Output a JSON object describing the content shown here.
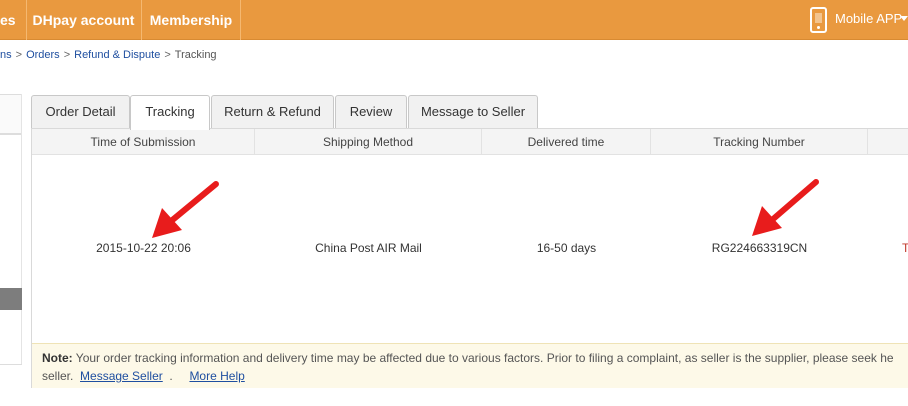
{
  "nav": {
    "items": [
      "es",
      "DHpay account",
      "Membership"
    ],
    "mobile_label": "Mobile APP"
  },
  "breadcrumb": {
    "items": [
      "ns",
      "Orders",
      "Refund & Dispute",
      "Tracking"
    ],
    "separator": ">"
  },
  "tabs": [
    {
      "label": "Order Detail"
    },
    {
      "label": "Tracking"
    },
    {
      "label": "Return & Refund"
    },
    {
      "label": "Review"
    },
    {
      "label": "Message to Seller"
    }
  ],
  "table": {
    "columns": [
      "Time of Submission",
      "Shipping Method",
      "Delivered time",
      "Tracking Number",
      ""
    ],
    "row": {
      "submission": "2015-10-22 20:06",
      "shipping_method": "China Post AIR Mail",
      "delivered_time": "16-50 days",
      "tracking_number": "RG224663319CN",
      "status_fragment": "T"
    }
  },
  "note": {
    "label": "Note:",
    "text": "Your order tracking information and delivery time may be affected due to various factors. Prior to filing a complaint, as seller is the supplier, please seek he",
    "line2_prefix": "seller.",
    "message_seller_link": "Message Seller",
    "dot": ".",
    "more_help_link": "More Help"
  },
  "colors": {
    "nav_bg": "#e9993f",
    "link": "#1f4fa0",
    "arrow": "#e81c1c",
    "note_bg": "#fdf9e8"
  }
}
